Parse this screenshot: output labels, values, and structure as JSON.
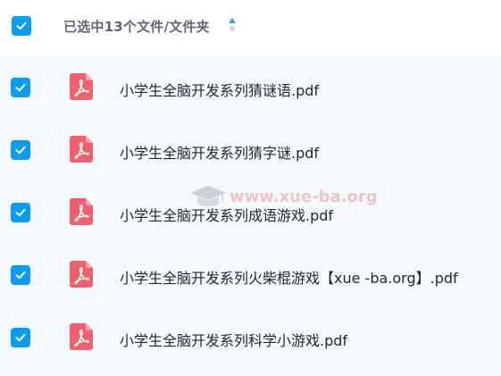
{
  "header": {
    "selection_text": "已选中13个文件/文件夹",
    "select_all_checked": true,
    "sort_icon": "sort-arrows-icon"
  },
  "files": [
    {
      "name": "小学生全脑开发系列猜谜语.pdf",
      "checked": true,
      "icon": "pdf-file-icon"
    },
    {
      "name": "小学生全脑开发系列猜字谜.pdf",
      "checked": true,
      "icon": "pdf-file-icon"
    },
    {
      "name": "小学生全脑开发系列成语游戏.pdf",
      "checked": true,
      "icon": "pdf-file-icon"
    },
    {
      "name": "小学生全脑开发系列火柴棍游戏【xue -ba.org】.pdf",
      "checked": true,
      "icon": "pdf-file-icon"
    },
    {
      "name": "小学生全脑开发系列科学小游戏.pdf",
      "checked": true,
      "icon": "pdf-file-icon"
    }
  ],
  "watermark": {
    "text": "www.xue-ba.org"
  },
  "colors": {
    "accent": "#0a9cf5",
    "pdf_red": "#f0606d",
    "list_bg": "#f4f9fd",
    "text": "#222633"
  }
}
